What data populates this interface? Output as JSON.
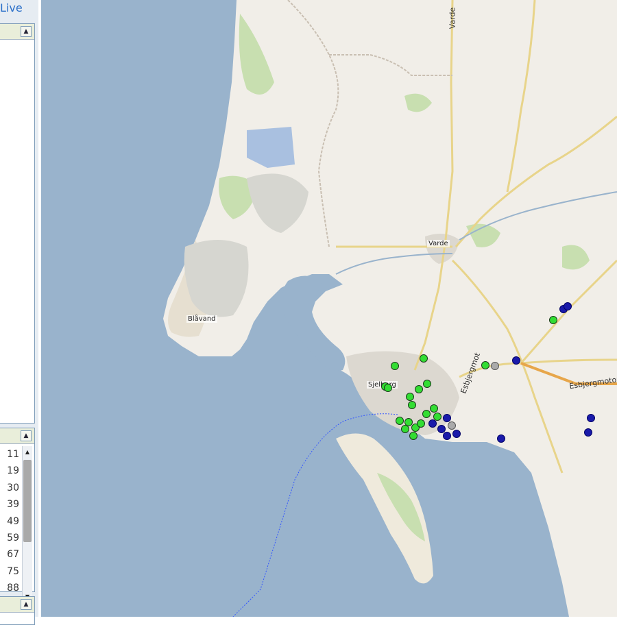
{
  "sidebar": {
    "live_label": "Live",
    "panels": [
      {
        "collapse_icon": "▲"
      },
      {
        "collapse_icon": "▲"
      },
      {
        "collapse_icon": "▲"
      }
    ],
    "list_numbers": [
      "11",
      "19",
      "30",
      "39",
      "49",
      "59",
      "67",
      "75",
      "88"
    ],
    "scroll_up_icon": "▲",
    "scroll_down_icon": "▼"
  },
  "map": {
    "colors": {
      "sea": "#99b3cc",
      "land": "#f1eee8",
      "green_marker": "#33dd33",
      "blue_marker": "#1a1aaa",
      "gray_marker": "#aaaaaa"
    },
    "place_labels": {
      "blavand": "Blåvand",
      "varde": "Varde",
      "sjelborg": "Sjelborg",
      "esbjerg": "Esbjerg",
      "road_esbjerg1": "Esbjergmotorvejen",
      "road_esbjerg2": "Esbjergmot",
      "varde_top": "Varde"
    }
  }
}
